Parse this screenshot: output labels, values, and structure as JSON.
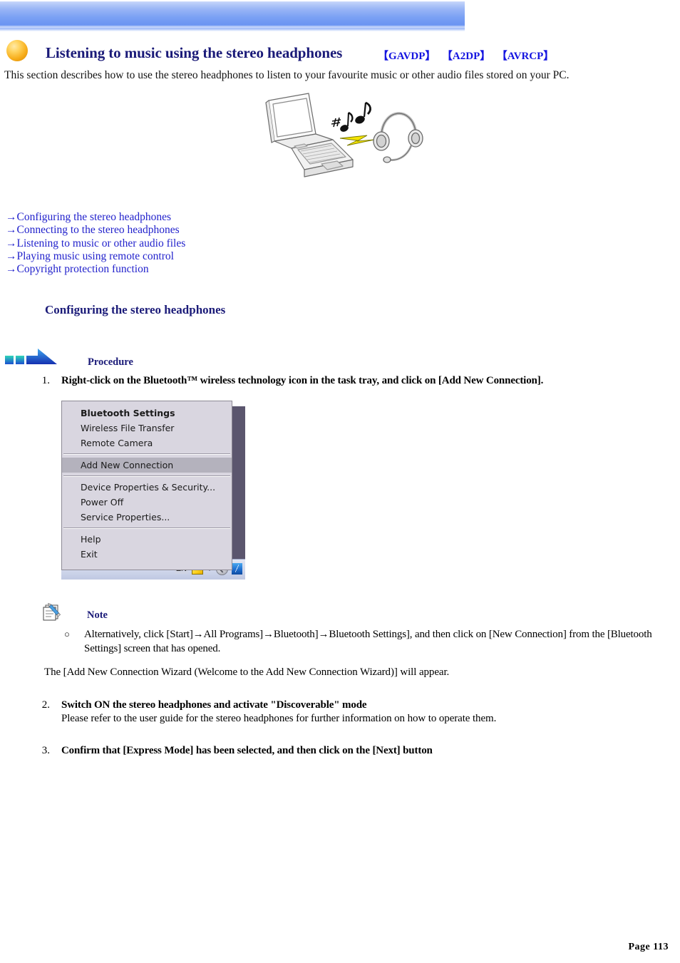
{
  "banner": {
    "accent_color": "#6a94f2"
  },
  "header": {
    "bullet_icon": "orange-sphere-icon",
    "title": "Listening to music using the stereo headphones",
    "profiles": [
      "【GAVDP】",
      "【A2DP】",
      "【AVRCP】"
    ],
    "profile_color": "#1414e0",
    "title_color": "#1a1a78"
  },
  "intro": {
    "paragraph": "This section describes how to use the stereo headphones to listen to your favourite music or other audio files stored on your PC."
  },
  "illustration": {
    "name": "laptop-music-headset-illustration",
    "elements": [
      "laptop",
      "music-notes",
      "lightning-bolt",
      "headset"
    ],
    "bolt_color": "#f5e400"
  },
  "links": [
    {
      "arrow": "→",
      "label": "Configuring the stereo headphones"
    },
    {
      "arrow": "→",
      "label": "Connecting to the stereo headphones"
    },
    {
      "arrow": "→",
      "label": "Listening to music or other audio files"
    },
    {
      "arrow": "→",
      "label": "Playing music using remote control"
    },
    {
      "arrow": "→",
      "label": "Copyright protection function"
    }
  ],
  "section": {
    "heading": "Configuring the stereo headphones"
  },
  "procedure": {
    "icon": "blue-arrow-icon",
    "label": "Procedure"
  },
  "steps": {
    "step1": {
      "number": "1.",
      "head": "Right-click on the Bluetooth™ wireless technology icon in the task tray, and click on [Add New Connection]."
    },
    "step2": {
      "number": "2.",
      "head": "Switch ON the stereo headphones and activate \"Discoverable\" mode",
      "sub": "Please refer to the user guide for the stereo headphones for further information on how to operate them."
    },
    "step3": {
      "number": "3.",
      "head": "Confirm that [Express Mode] has been selected, and then click on the [Next] button"
    }
  },
  "menu_screenshot": {
    "items": [
      {
        "label": "Bluetooth Settings",
        "bold": true,
        "selected": false
      },
      {
        "label": "Wireless File Transfer",
        "bold": false,
        "selected": false
      },
      {
        "label": "Remote Camera",
        "bold": false,
        "selected": false
      },
      {
        "label": "Add New Connection",
        "bold": false,
        "selected": true
      },
      {
        "label": "Device Properties & Security...",
        "bold": false,
        "selected": false
      },
      {
        "label": "Power Off",
        "bold": false,
        "selected": false
      },
      {
        "label": "Service Properties...",
        "bold": false,
        "selected": false
      },
      {
        "label": "Help",
        "bold": false,
        "selected": false
      },
      {
        "label": "Exit",
        "bold": false,
        "selected": false
      }
    ],
    "taskbar": {
      "language": "EN",
      "icons": [
        "note-balloon-icon",
        "chevron-down-icon",
        "gray-circle-icon",
        "bluetooth-icon"
      ]
    },
    "selected_bg": "#b4b2bd",
    "panel_bg": "#d9d6e0"
  },
  "note": {
    "icon": "notepad-pencil-icon",
    "label": "Note",
    "bullet": "○",
    "text": "Alternatively, click [Start]→All Programs]→Bluetooth]→Bluetooth Settings], and then click on [New Connection] from the [Bluetooth Settings] screen that has opened.",
    "wizard_line": "The [Add New Connection Wizard (Welcome to the Add New Connection Wizard)] will appear."
  },
  "footer": {
    "page_label": "Page 113"
  }
}
